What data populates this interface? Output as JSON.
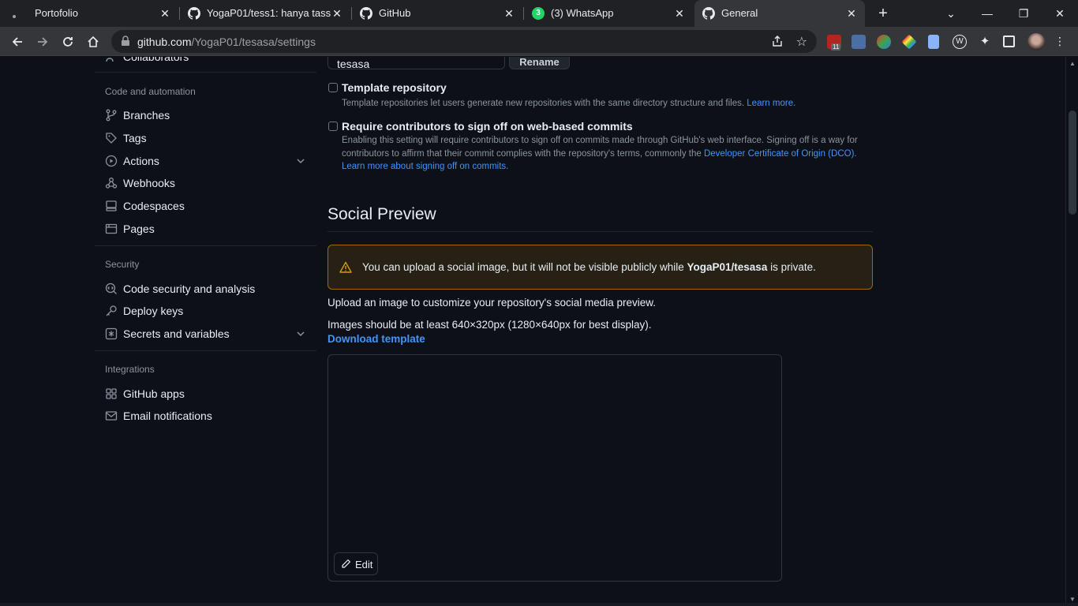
{
  "browser": {
    "tabs": [
      {
        "title": "Portofolio",
        "icon": "dot-favicon"
      },
      {
        "title": "YogaP01/tess1: hanya tass",
        "icon": "github-icon"
      },
      {
        "title": "GitHub",
        "icon": "github-icon"
      },
      {
        "title": "(3) WhatsApp",
        "icon": "whatsapp-icon",
        "badge": "3"
      },
      {
        "title": "General",
        "icon": "github-icon",
        "active": true
      }
    ],
    "url_host": "github.com",
    "url_path": "/YogaP01/tesasa/settings",
    "extension_badge": "11"
  },
  "sidebar": {
    "collaborators": "Collaborators",
    "code_automation_heading": "Code and automation",
    "branches": "Branches",
    "tags": "Tags",
    "actions": "Actions",
    "webhooks": "Webhooks",
    "codespaces": "Codespaces",
    "pages": "Pages",
    "security_heading": "Security",
    "code_security": "Code security and analysis",
    "deploy_keys": "Deploy keys",
    "secrets": "Secrets and variables",
    "integrations_heading": "Integrations",
    "github_apps": "GitHub apps",
    "email_notifications": "Email notifications"
  },
  "main": {
    "repo_name_value": "tesasa",
    "rename_label": "Rename",
    "template_repo_title": "Template repository",
    "template_repo_desc": "Template repositories let users generate new repositories with the same directory structure and files.",
    "learn_more": "Learn more.",
    "signoff_title": "Require contributors to sign off on web-based commits",
    "signoff_desc_1": "Enabling this setting will require contributors to sign off on commits made through GitHub's web interface. Signing off is a way for contributors to affirm that their commit complies with the repository's terms, commonly the",
    "signoff_link_dco": "Developer Certificate of Origin (DCO).",
    "signoff_link_learn": "Learn more about signing off on commits.",
    "social_preview_title": "Social Preview",
    "flash_text_pre": "You can upload a social image, but it will not be visible publicly while",
    "flash_repo": "YogaP01/tesasa",
    "flash_text_post": "is private.",
    "upload_text": "Upload an image to customize your repository's social media preview.",
    "size_text": "Images should be at least 640×320px (1280×640px for best display).",
    "download_template": "Download template",
    "edit_label": "Edit"
  }
}
